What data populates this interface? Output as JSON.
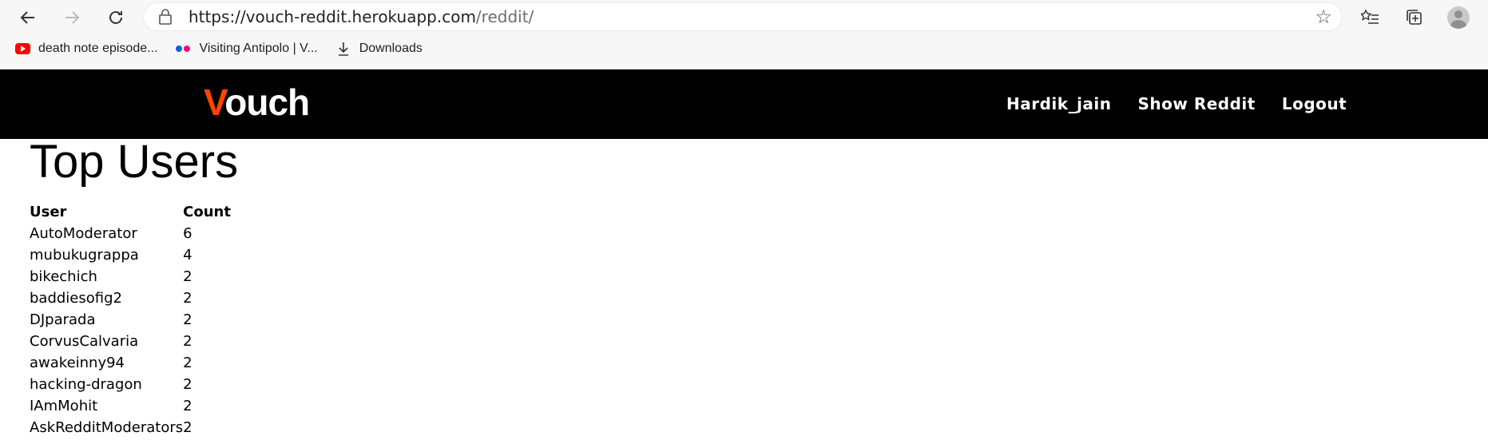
{
  "browser": {
    "url_host": "https://vouch-reddit.herokuapp.com",
    "url_path": "/reddit/",
    "bookmarks": [
      {
        "label": "death note episode...",
        "icon": "youtube-icon"
      },
      {
        "label": "Visiting Antipolo | V...",
        "icon": "flickr-icon"
      },
      {
        "label": "Downloads",
        "icon": "download-icon"
      }
    ]
  },
  "site": {
    "logo_first": "V",
    "logo_rest": "ouch",
    "brand_accent": "#ff4500",
    "nav": {
      "user": "Hardik_jain",
      "show_reddit": "Show Reddit",
      "logout": "Logout"
    }
  },
  "main": {
    "title": "Top Users",
    "columns": [
      "User",
      "Count"
    ],
    "rows": [
      {
        "user": "AutoModerator",
        "count": "6"
      },
      {
        "user": "mubukugrappa",
        "count": "4"
      },
      {
        "user": "bikechich",
        "count": "2"
      },
      {
        "user": "baddiesofig2",
        "count": "2"
      },
      {
        "user": "DJparada",
        "count": "2"
      },
      {
        "user": "CorvusCalvaria",
        "count": "2"
      },
      {
        "user": "awakeinny94",
        "count": "2"
      },
      {
        "user": "hacking-dragon",
        "count": "2"
      },
      {
        "user": "IAmMohit",
        "count": "2"
      },
      {
        "user": "AskRedditModerators",
        "count": "2"
      }
    ]
  }
}
